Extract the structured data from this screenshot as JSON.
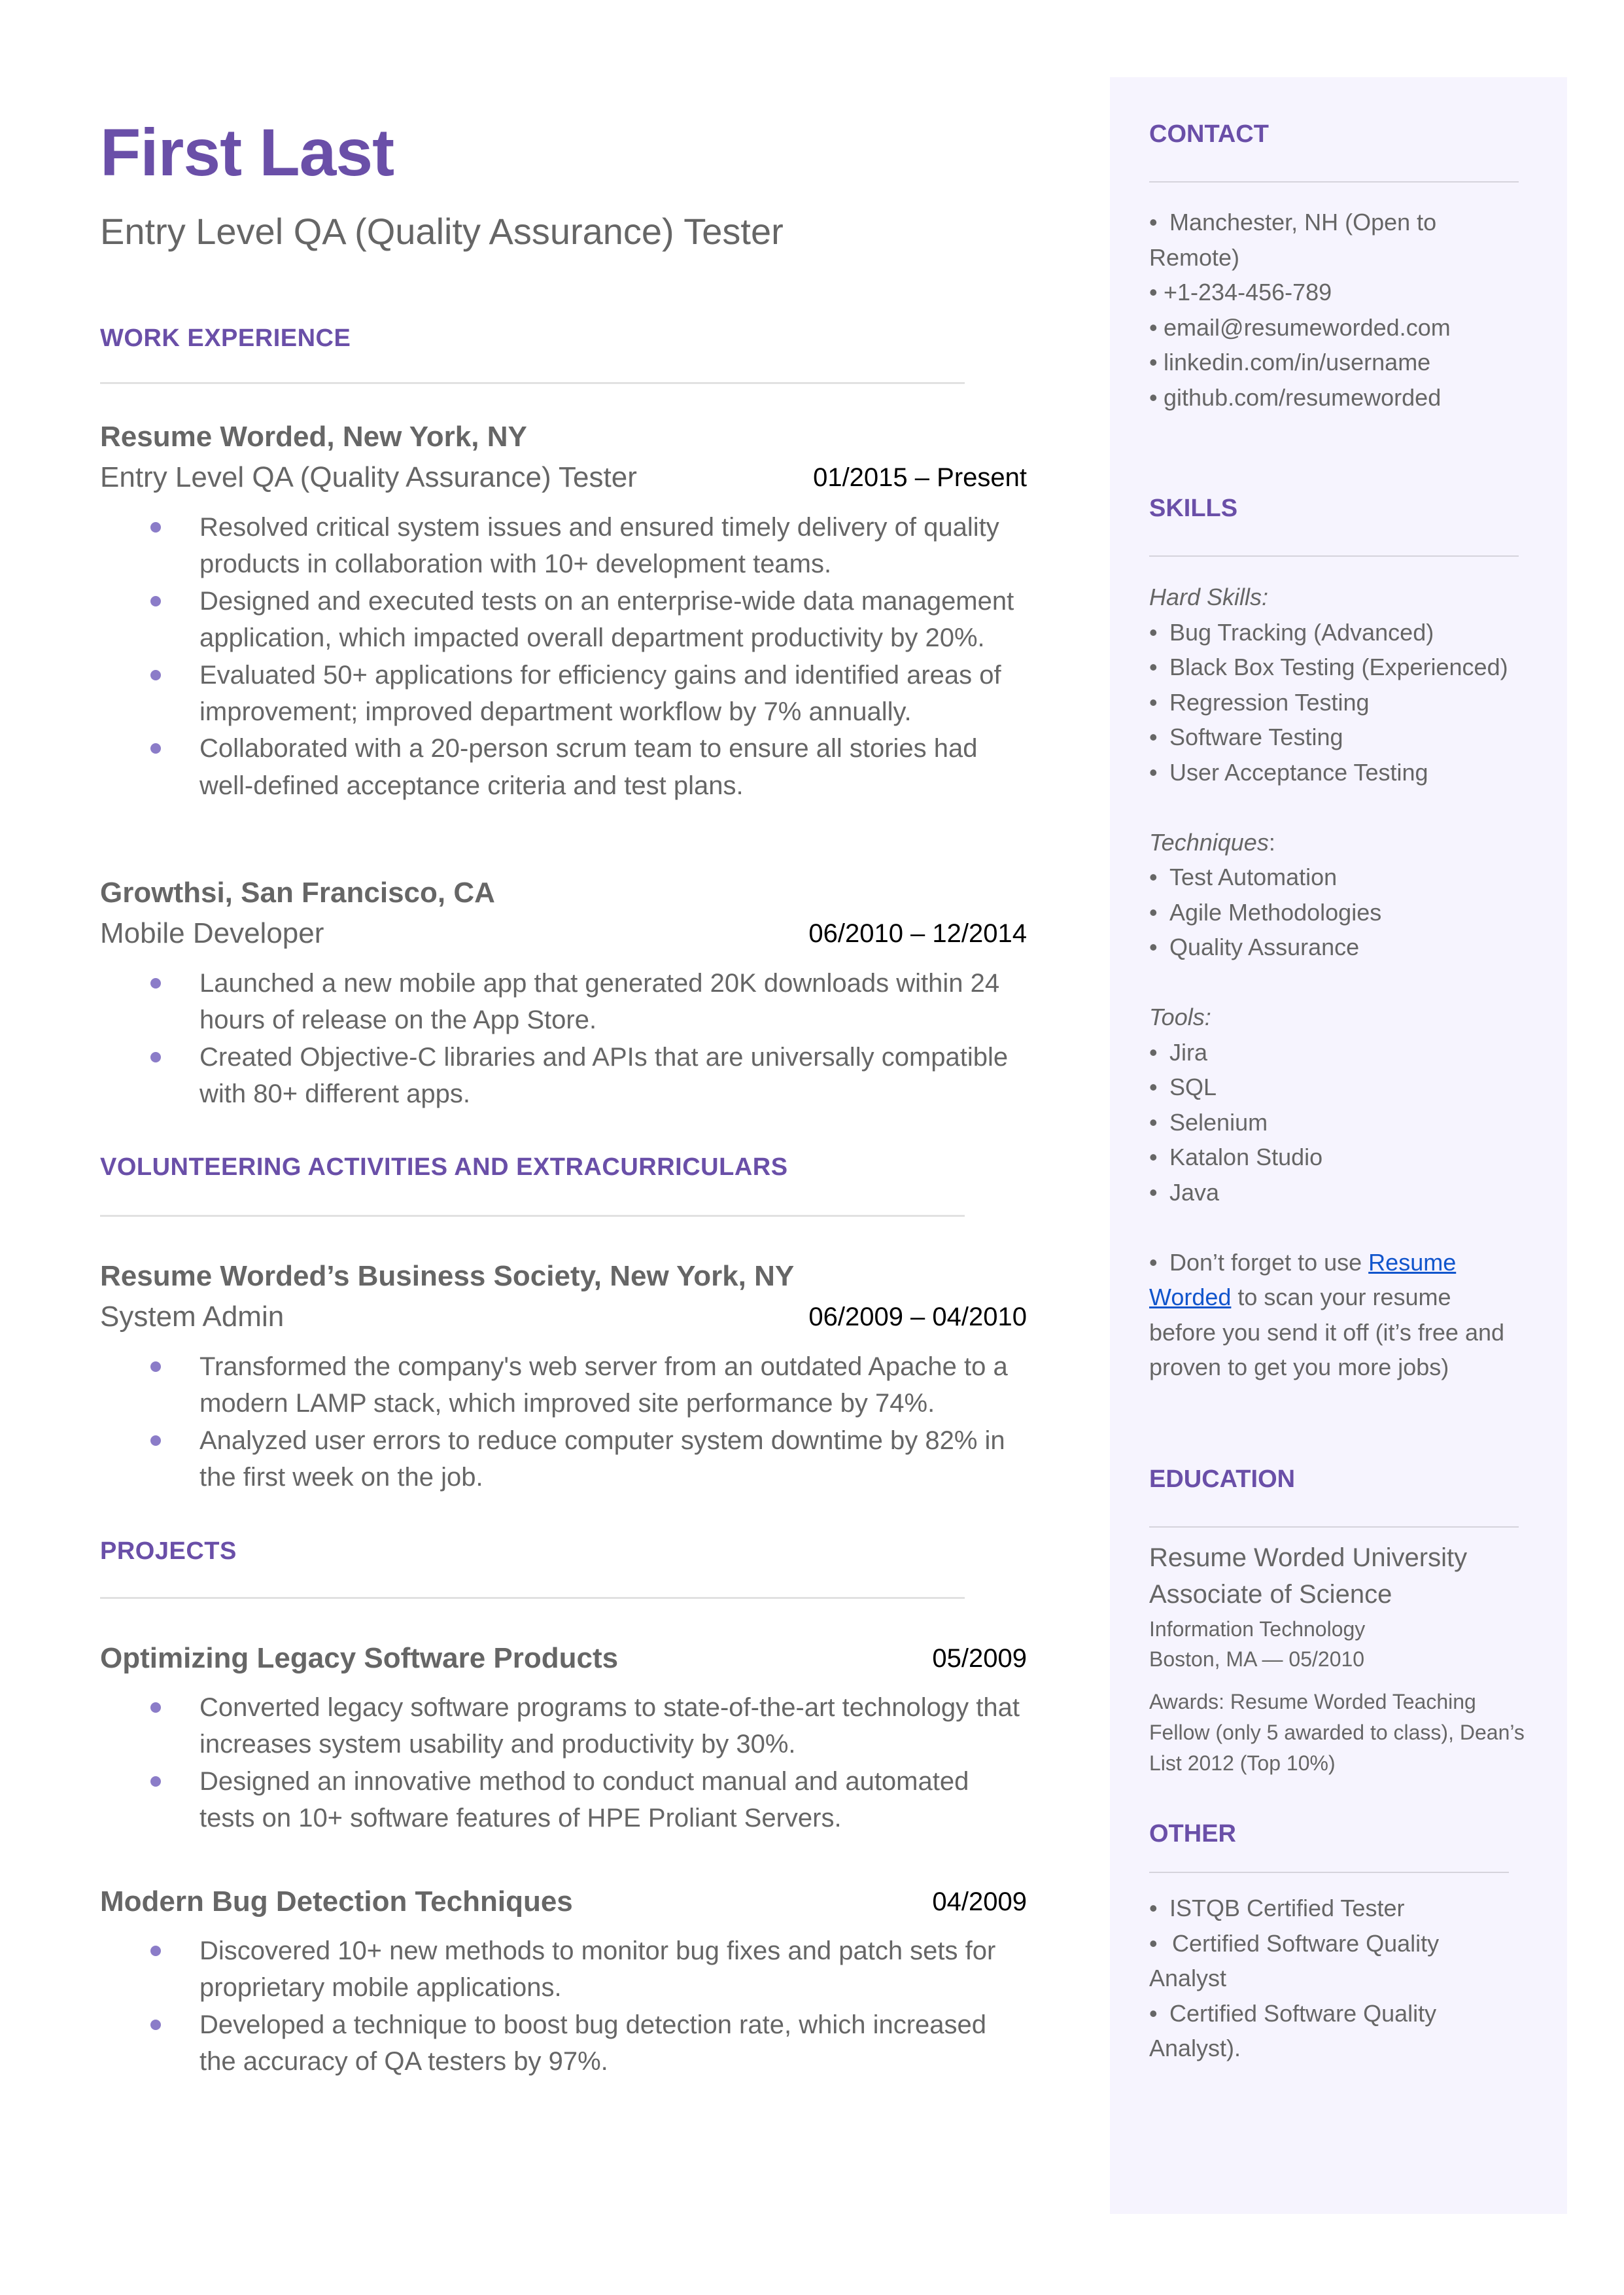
{
  "header": {
    "name": "First Last",
    "title": "Entry Level QA (Quality Assurance) Tester"
  },
  "colors": {
    "accent": "#6a4fa8",
    "bullet": "#8b7cc8",
    "sidebar_bg": "#f6f4fe",
    "body_text": "#666666",
    "link": "#1155cc"
  },
  "work_experience": {
    "heading": "WORK EXPERIENCE",
    "jobs": [
      {
        "org": "Resume Worded, New York, NY",
        "role": "Entry Level QA (Quality Assurance) Tester",
        "dates": "01/2015 – Present",
        "bullets": [
          "Resolved critical system issues and ensured timely delivery of quality products in collaboration with 10+ development teams.",
          "Designed and executed tests on an enterprise-wide data management application, which impacted overall department productivity by 20%.",
          "Evaluated 50+ applications for efficiency gains and identified areas of improvement; improved department workflow by 7% annually.",
          "Collaborated with a 20-person scrum team to ensure all stories had well-defined acceptance criteria and test plans."
        ]
      },
      {
        "org": "Growthsi, San Francisco, CA",
        "role": "Mobile Developer",
        "dates": "06/2010 – 12/2014",
        "bullets": [
          "Launched a new mobile app that generated 20K downloads within 24 hours of release on the App Store.",
          "Created Objective-C libraries and APIs that are universally compatible with 80+ different apps."
        ]
      }
    ]
  },
  "volunteering": {
    "heading": "VOLUNTEERING ACTIVITIES AND EXTRACURRICULARS",
    "entries": [
      {
        "org": "Resume Worded’s Business Society, New York, NY",
        "role": "System Admin",
        "dates": "06/2009 – 04/2010",
        "bullets": [
          "Transformed the company's web server from an outdated Apache to a modern LAMP stack, which improved site performance by 74%.",
          "Analyzed user errors to reduce computer system downtime by 82% in the first week on the job."
        ]
      }
    ]
  },
  "projects": {
    "heading": "PROJECTS",
    "entries": [
      {
        "title": "Optimizing Legacy Software Products",
        "date": "05/2009",
        "bullets": [
          "Converted legacy software programs to state-of-the-art technology that increases system usability and productivity by 30%.",
          "Designed an innovative method to conduct manual and automated tests on 10+ software features of HPE Proliant Servers."
        ]
      },
      {
        "title": "Modern Bug Detection Techniques",
        "date": "04/2009",
        "bullets": [
          "Discovered 10+ new methods to monitor bug fixes and patch sets for proprietary mobile applications.",
          "Developed a technique to boost bug detection rate, which increased the accuracy of QA testers by 97%."
        ]
      }
    ]
  },
  "sidebar": {
    "contact": {
      "heading": "CONTACT",
      "location_line1": "Manchester, NH (Open to",
      "location_line2": "Remote)",
      "items": [
        "+1-234-456-789",
        "email@resumeworded.com",
        "linkedin.com/in/username",
        "github.com/resumeworded"
      ]
    },
    "skills": {
      "heading": "SKILLS",
      "hard_label": "Hard Skills:",
      "hard": [
        "Bug Tracking (Advanced)",
        "Black Box Testing (Experienced)",
        "Regression Testing",
        "Software Testing",
        "User Acceptance Testing"
      ],
      "techniques_label": "Techniques",
      "techniques_colon": ":",
      "techniques": [
        "Test Automation",
        "Agile Methodologies",
        "Quality Assurance"
      ],
      "tools_label": "Tools:",
      "tools": [
        "Jira",
        "SQL",
        "Selenium",
        "Katalon Studio",
        "Java"
      ],
      "tip_prefix": "Don’t forget to use ",
      "tip_link_line1": "Resume",
      "tip_link_line2": "Worded",
      "tip_rest_line2": " to scan your resume",
      "tip_line3": "before you send it off (it’s free and",
      "tip_line4": "proven to get you more jobs)"
    },
    "education": {
      "heading": "EDUCATION",
      "school": "Resume Worded University",
      "degree": "Associate of Science",
      "field": "Information Technology",
      "location_date": "Boston, MA — 05/2010",
      "awards": "Awards: Resume Worded Teaching Fellow (only 5 awarded to class), Dean’s List 2012 (Top 10%)"
    },
    "other": {
      "heading": "OTHER",
      "items_line": [
        "ISTQB Certified Tester",
        "Certified Software Quality",
        "Analyst",
        "Certified Software Quality",
        "Analyst)."
      ]
    }
  }
}
